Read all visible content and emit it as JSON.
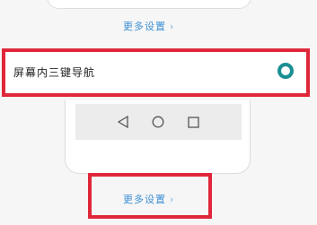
{
  "more_settings_top": {
    "label": "更多设置",
    "chevron": "›"
  },
  "nav_option": {
    "label": "屏幕内三键导航",
    "selected": true,
    "accent_color": "#1a8f93"
  },
  "nav_preview": {
    "icons": [
      "back-triangle-icon",
      "home-circle-icon",
      "recents-square-icon"
    ]
  },
  "more_settings_bottom": {
    "label": "更多设置",
    "chevron": "›"
  },
  "colors": {
    "highlight": "#e0273a",
    "link": "#3b8fd4"
  }
}
